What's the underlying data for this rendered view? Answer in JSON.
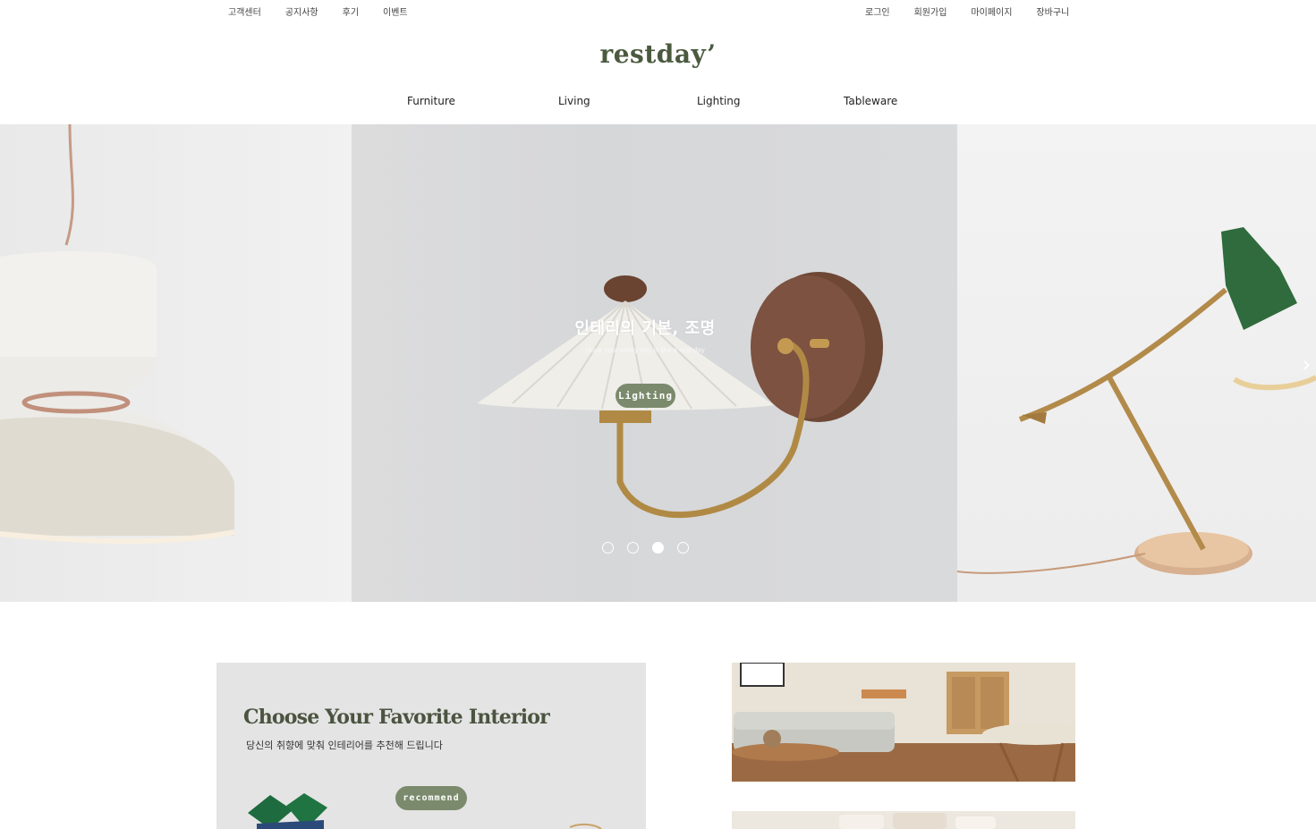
{
  "topbar": {
    "left": [
      "고객센터",
      "공지사항",
      "후기",
      "이벤트"
    ],
    "right": [
      "로그인",
      "회원가입",
      "마이페이지",
      "장바구니"
    ]
  },
  "logo": {
    "text": "restday’"
  },
  "nav": [
    "Furniture",
    "Living",
    "Lighting",
    "Tableware"
  ],
  "hero": {
    "title": "인테리의 기본, 조명",
    "subtitle": "Hope your every day is like a rest day",
    "button": "Lighting",
    "next_arrow": "›",
    "dots": {
      "total": 4,
      "active_index": 2
    }
  },
  "promo": {
    "title": "Choose Your Favorite Interior",
    "subtitle": "당신의 취향에 맞춰 인테리어를 추천해 드립니다",
    "button": "recommend"
  },
  "colors": {
    "brand_green": "#4b5a3f",
    "button_green": "#7b8a6c",
    "lamp_green": "#2f6b3c"
  }
}
